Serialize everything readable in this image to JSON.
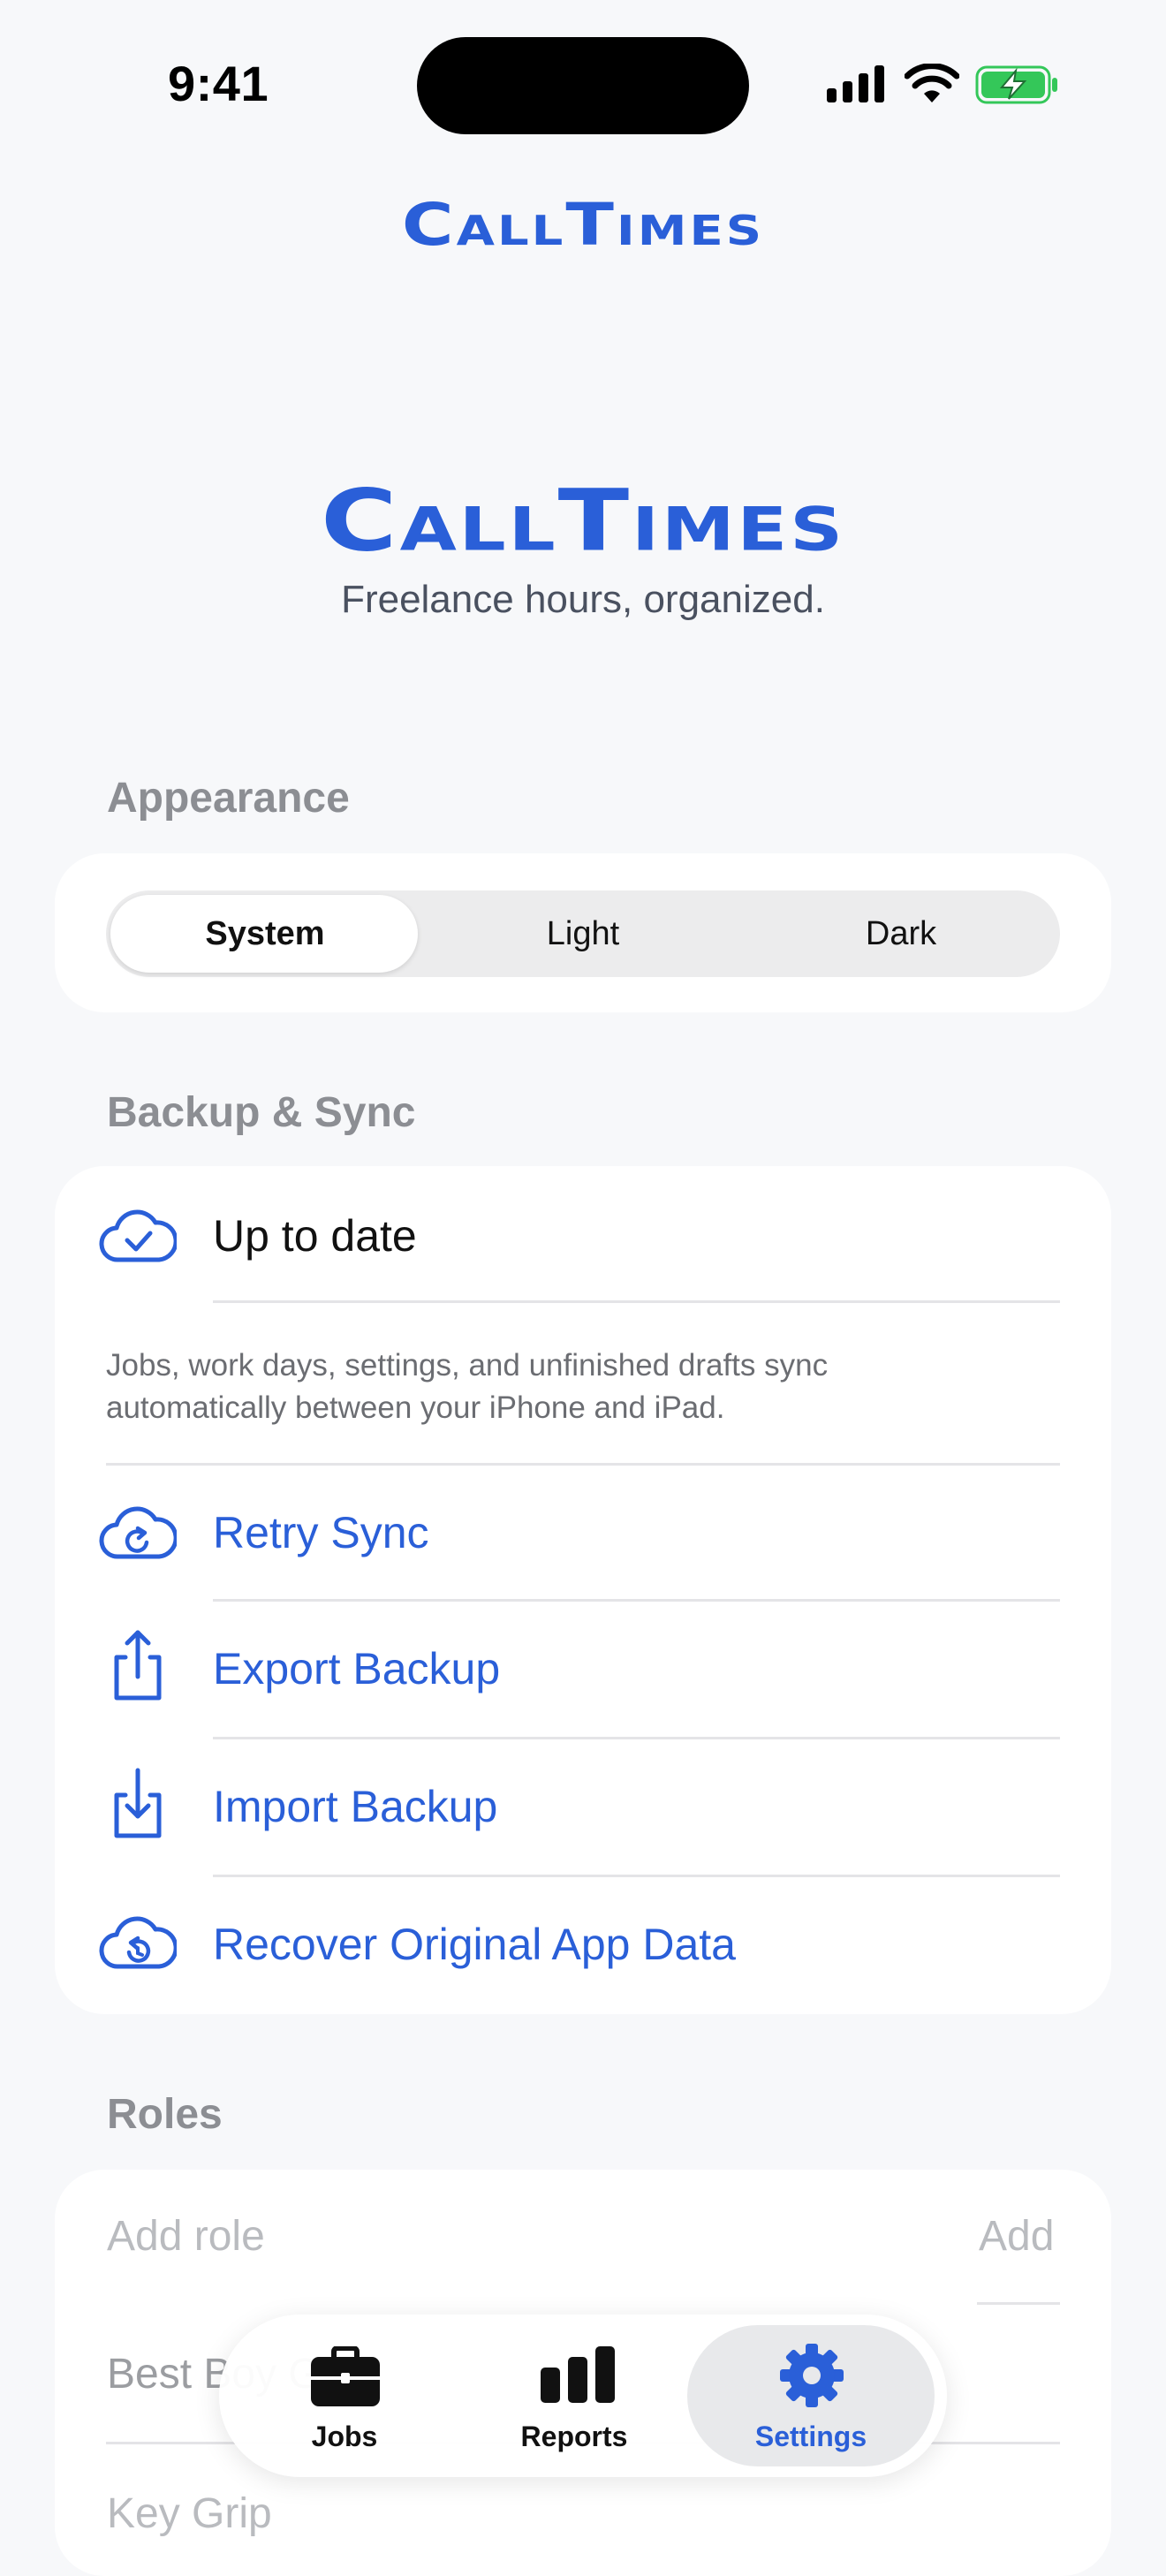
{
  "status_bar": {
    "time": "9:41"
  },
  "app": {
    "name": "CallTimes",
    "tagline": "Freelance hours, organized."
  },
  "appearance": {
    "header": "Appearance",
    "options": [
      "System",
      "Light",
      "Dark"
    ],
    "selected": "System"
  },
  "backup": {
    "header": "Backup & Sync",
    "status": "Up to date",
    "description_line1": "Jobs, work days, settings, and unfinished drafts sync",
    "description_line2": "automatically between your iPhone and iPad.",
    "actions": [
      {
        "label": "Retry Sync",
        "icon": "cloud-retry-icon"
      },
      {
        "label": "Export Backup",
        "icon": "share-icon"
      },
      {
        "label": "Import Backup",
        "icon": "download-tray-icon"
      },
      {
        "label": "Recover Original App Data",
        "icon": "cloud-restore-icon"
      }
    ]
  },
  "roles": {
    "header": "Roles",
    "add_placeholder": "Add role",
    "add_button": "Add",
    "items": [
      "Best Boy G",
      "Key Grip"
    ]
  },
  "tab_bar": {
    "tabs": [
      {
        "label": "Jobs",
        "icon": "briefcase-icon"
      },
      {
        "label": "Reports",
        "icon": "bar-chart-icon"
      },
      {
        "label": "Settings",
        "icon": "gear-icon"
      }
    ],
    "active": "Settings"
  },
  "colors": {
    "accent": "#2a5fd8",
    "battery": "#34c759"
  }
}
